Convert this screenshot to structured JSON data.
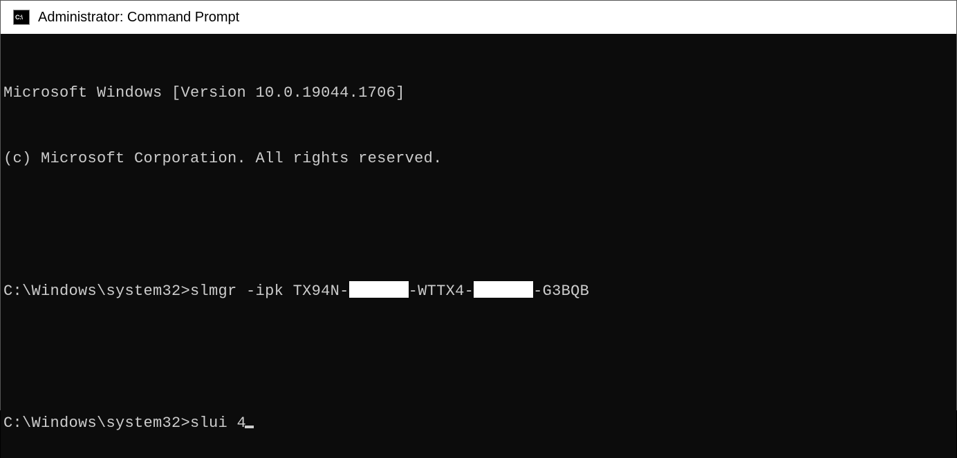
{
  "titleBar": {
    "iconLabel": "C:\\",
    "title": "Administrator: Command Prompt"
  },
  "terminal": {
    "versionLine": "Microsoft Windows [Version 10.0.19044.1706]",
    "copyrightLine": "(c) Microsoft Corporation. All rights reserved.",
    "commands": [
      {
        "prompt": "C:\\Windows\\system32>",
        "cmdPart1": "slmgr -ipk TX94N-",
        "cmdPart2": "-WTTX4-",
        "cmdPart3": "-G3BQB",
        "redacted": true
      },
      {
        "prompt": "C:\\Windows\\system32>",
        "cmd": "slui 4",
        "cursor": true
      }
    ]
  }
}
